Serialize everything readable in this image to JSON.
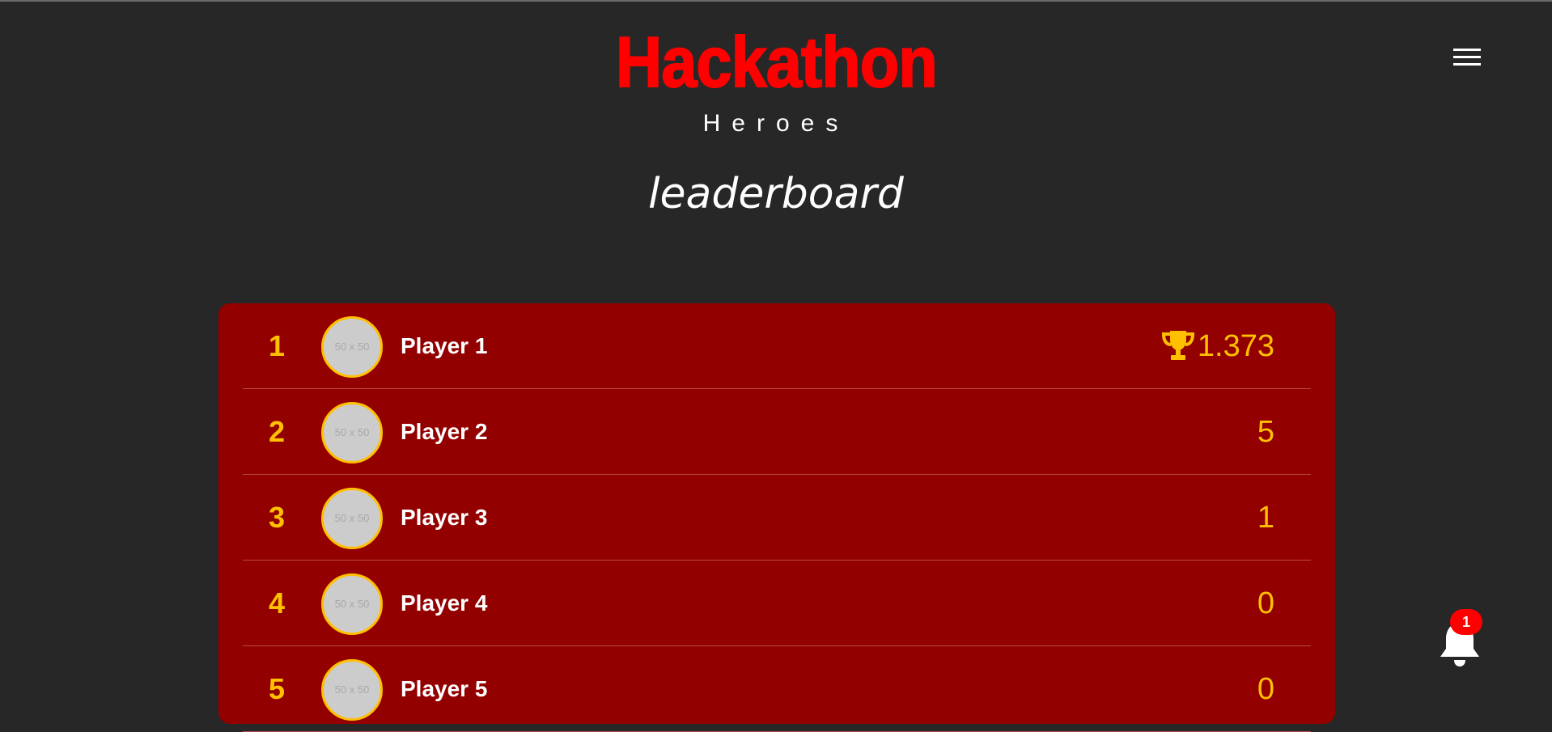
{
  "header": {
    "logo_title": "Hackathon",
    "logo_subtitle": "Heroes",
    "menu_icon": "hamburger-menu-icon"
  },
  "main": {
    "title": "leaderboard"
  },
  "leaderboard": {
    "avatar_placeholder": "50 x 50",
    "rows": [
      {
        "rank": "1",
        "name": "Player 1",
        "score": "1.373",
        "trophy": true
      },
      {
        "rank": "2",
        "name": "Player 2",
        "score": "5",
        "trophy": false
      },
      {
        "rank": "3",
        "name": "Player 3",
        "score": "1",
        "trophy": false
      },
      {
        "rank": "4",
        "name": "Player 4",
        "score": "0",
        "trophy": false
      },
      {
        "rank": "5",
        "name": "Player 5",
        "score": "0",
        "trophy": false
      }
    ]
  },
  "notifications": {
    "icon": "bell-icon",
    "count": "1"
  },
  "colors": {
    "background": "#272727",
    "brand_red": "#ff0000",
    "board_red": "#930000",
    "accent_gold": "#ffc000"
  }
}
